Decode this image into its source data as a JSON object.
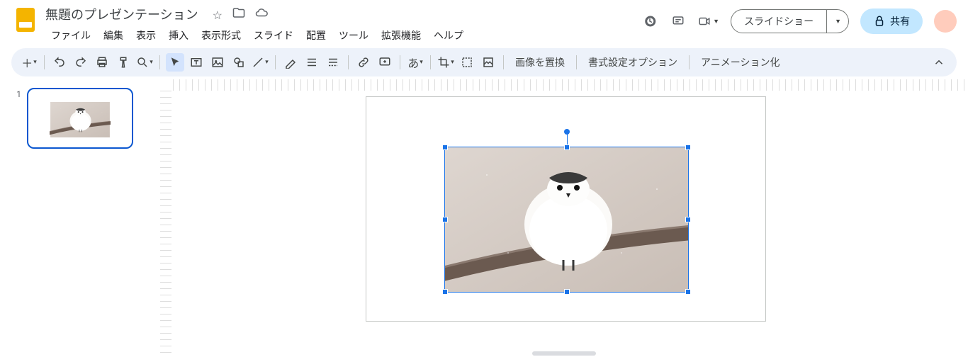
{
  "header": {
    "doc_title": "無題のプレゼンテーション",
    "menus": [
      "ファイル",
      "編集",
      "表示",
      "挿入",
      "表示形式",
      "スライド",
      "配置",
      "ツール",
      "拡張機能",
      "ヘルプ"
    ],
    "slideshow": "スライドショー",
    "share": "共有"
  },
  "toolbar": {
    "replace_image": "画像を置換",
    "format_options": "書式設定オプション",
    "animate": "アニメーション化",
    "input_lang": "あ"
  },
  "slides": {
    "current_number": "1"
  }
}
